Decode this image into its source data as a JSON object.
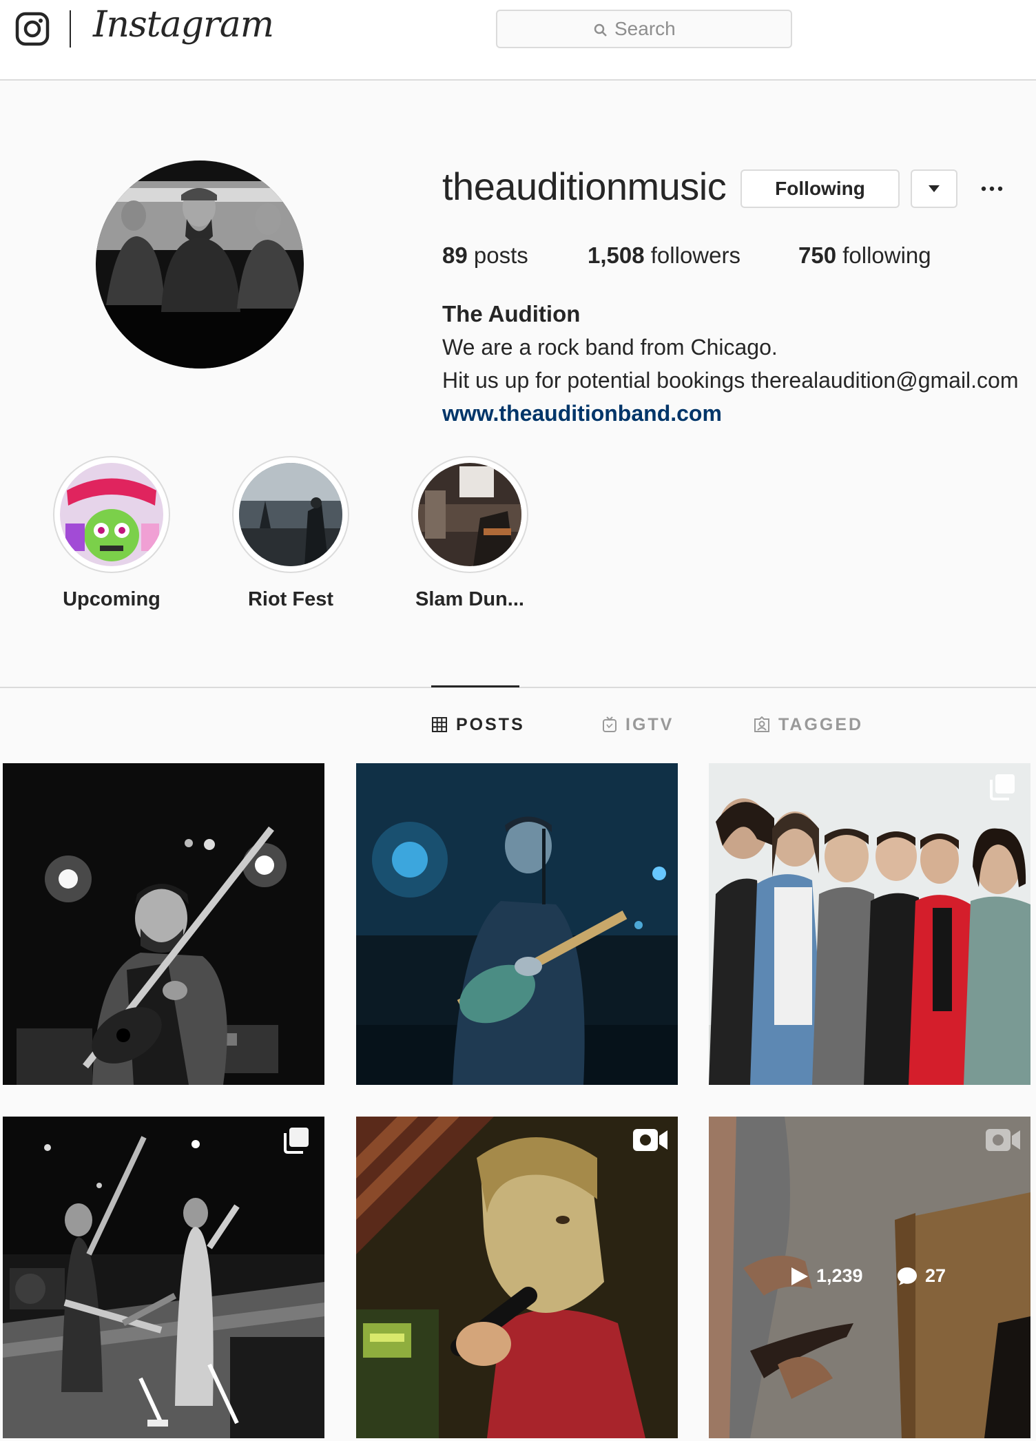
{
  "nav": {
    "wordmark": "Instagram",
    "search_placeholder": "Search"
  },
  "profile": {
    "username": "theauditionmusic",
    "follow_button": "Following",
    "stats": {
      "posts_count": "89",
      "posts_label": "posts",
      "followers_count": "1,508",
      "followers_label": "followers",
      "following_count": "750",
      "following_label": "following"
    },
    "bio": {
      "full_name": "The Audition",
      "line1": "We are a rock band from Chicago.",
      "line2": "Hit us up for potential bookings therealaudition@gmail.com",
      "website": "www.theauditionband.com"
    }
  },
  "highlights": [
    {
      "label": "Upcoming"
    },
    {
      "label": "Riot Fest"
    },
    {
      "label": "Slam Dun..."
    }
  ],
  "tabs": [
    {
      "label": "POSTS",
      "active": true,
      "icon": "grid-icon"
    },
    {
      "label": "IGTV",
      "active": false,
      "icon": "igtv-icon"
    },
    {
      "label": "TAGGED",
      "active": false,
      "icon": "tagged-icon"
    }
  ],
  "posts": [
    {
      "description": "guitarist black and white",
      "badge": null
    },
    {
      "description": "guitarist blue stage",
      "badge": null
    },
    {
      "description": "band group photo",
      "badge": "carousel-icon"
    },
    {
      "description": "band on stage black and white",
      "badge": "carousel-icon"
    },
    {
      "description": "singer with microphone",
      "badge": "video-icon"
    },
    {
      "description": "video still",
      "badge": "video-icon",
      "hover_stats": {
        "plays": "1,239",
        "comments": "27"
      }
    }
  ],
  "colors": {
    "link": "#003569",
    "border": "#dbdbdb",
    "background": "#fafafa"
  }
}
